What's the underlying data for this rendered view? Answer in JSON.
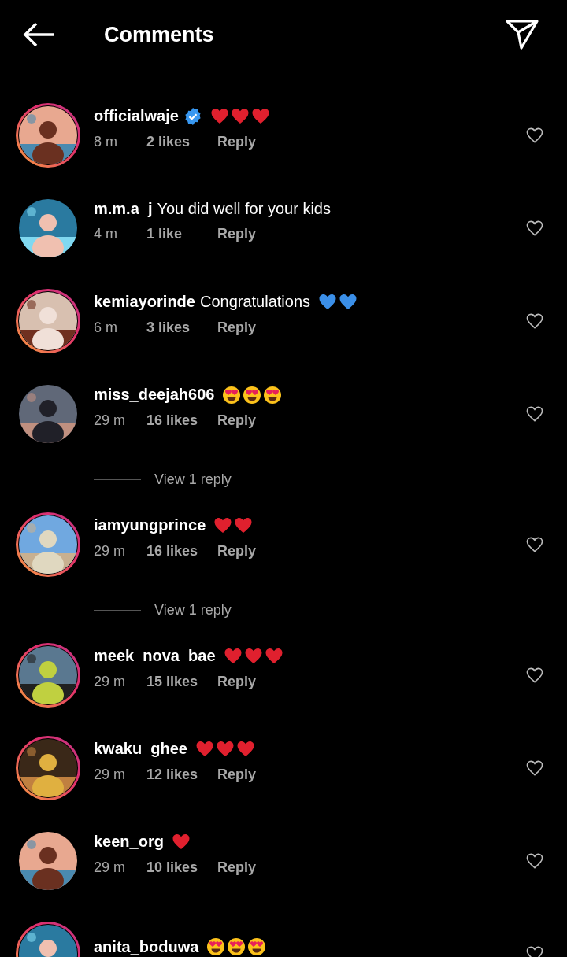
{
  "header": {
    "title": "Comments"
  },
  "comments": [
    {
      "kind": "comment",
      "username": "officialwaje",
      "verified": true,
      "story": true,
      "emojis": [
        {
          "kind": "heart"
        },
        {
          "kind": "heart"
        },
        {
          "kind": "heart"
        }
      ],
      "time": "8 m",
      "likes": "2 likes",
      "reply": "Reply"
    },
    {
      "kind": "comment",
      "username": "m.m.a_j",
      "verified": false,
      "story": false,
      "text": "You did well for your kids",
      "time": "4 m",
      "likes": "1 like",
      "reply": "Reply"
    },
    {
      "kind": "comment",
      "username": "kemiayorinde",
      "verified": false,
      "story": true,
      "text": "Congratulations",
      "emojis": [
        {
          "kind": "blue-heart"
        },
        {
          "kind": "blue-heart"
        }
      ],
      "time": "6 m",
      "likes": "3 likes",
      "reply": "Reply"
    },
    {
      "kind": "comment",
      "username": "miss_deejah606",
      "verified": false,
      "story": false,
      "emojis": [
        {
          "kind": "heart-eyes"
        },
        {
          "kind": "heart-eyes"
        },
        {
          "kind": "heart-eyes"
        }
      ],
      "time": "29 m",
      "likes": "16 likes",
      "reply": "Reply"
    },
    {
      "kind": "view-replies",
      "label": "View 1 reply"
    },
    {
      "kind": "comment",
      "username": "iamyungprince",
      "verified": false,
      "story": true,
      "emojis": [
        {
          "kind": "heart"
        },
        {
          "kind": "heart"
        }
      ],
      "time": "29 m",
      "likes": "16 likes",
      "reply": "Reply"
    },
    {
      "kind": "view-replies",
      "label": "View 1 reply"
    },
    {
      "kind": "comment",
      "username": "meek_nova_bae",
      "verified": false,
      "story": true,
      "emojis": [
        {
          "kind": "heart"
        },
        {
          "kind": "heart"
        },
        {
          "kind": "heart"
        }
      ],
      "time": "29 m",
      "likes": "15 likes",
      "reply": "Reply"
    },
    {
      "kind": "comment",
      "username": "kwaku_ghee",
      "verified": false,
      "story": true,
      "emojis": [
        {
          "kind": "heart"
        },
        {
          "kind": "heart"
        },
        {
          "kind": "heart"
        }
      ],
      "time": "29 m",
      "likes": "12 likes",
      "reply": "Reply"
    },
    {
      "kind": "comment",
      "username": "keen_org",
      "verified": false,
      "story": false,
      "emojis": [
        {
          "kind": "heart"
        }
      ],
      "time": "29 m",
      "likes": "10 likes",
      "reply": "Reply"
    },
    {
      "kind": "comment",
      "username": "anita_boduwa",
      "verified": false,
      "story": true,
      "emojis": [
        {
          "kind": "heart-eyes"
        },
        {
          "kind": "heart-eyes"
        },
        {
          "kind": "heart-eyes"
        }
      ]
    }
  ]
}
